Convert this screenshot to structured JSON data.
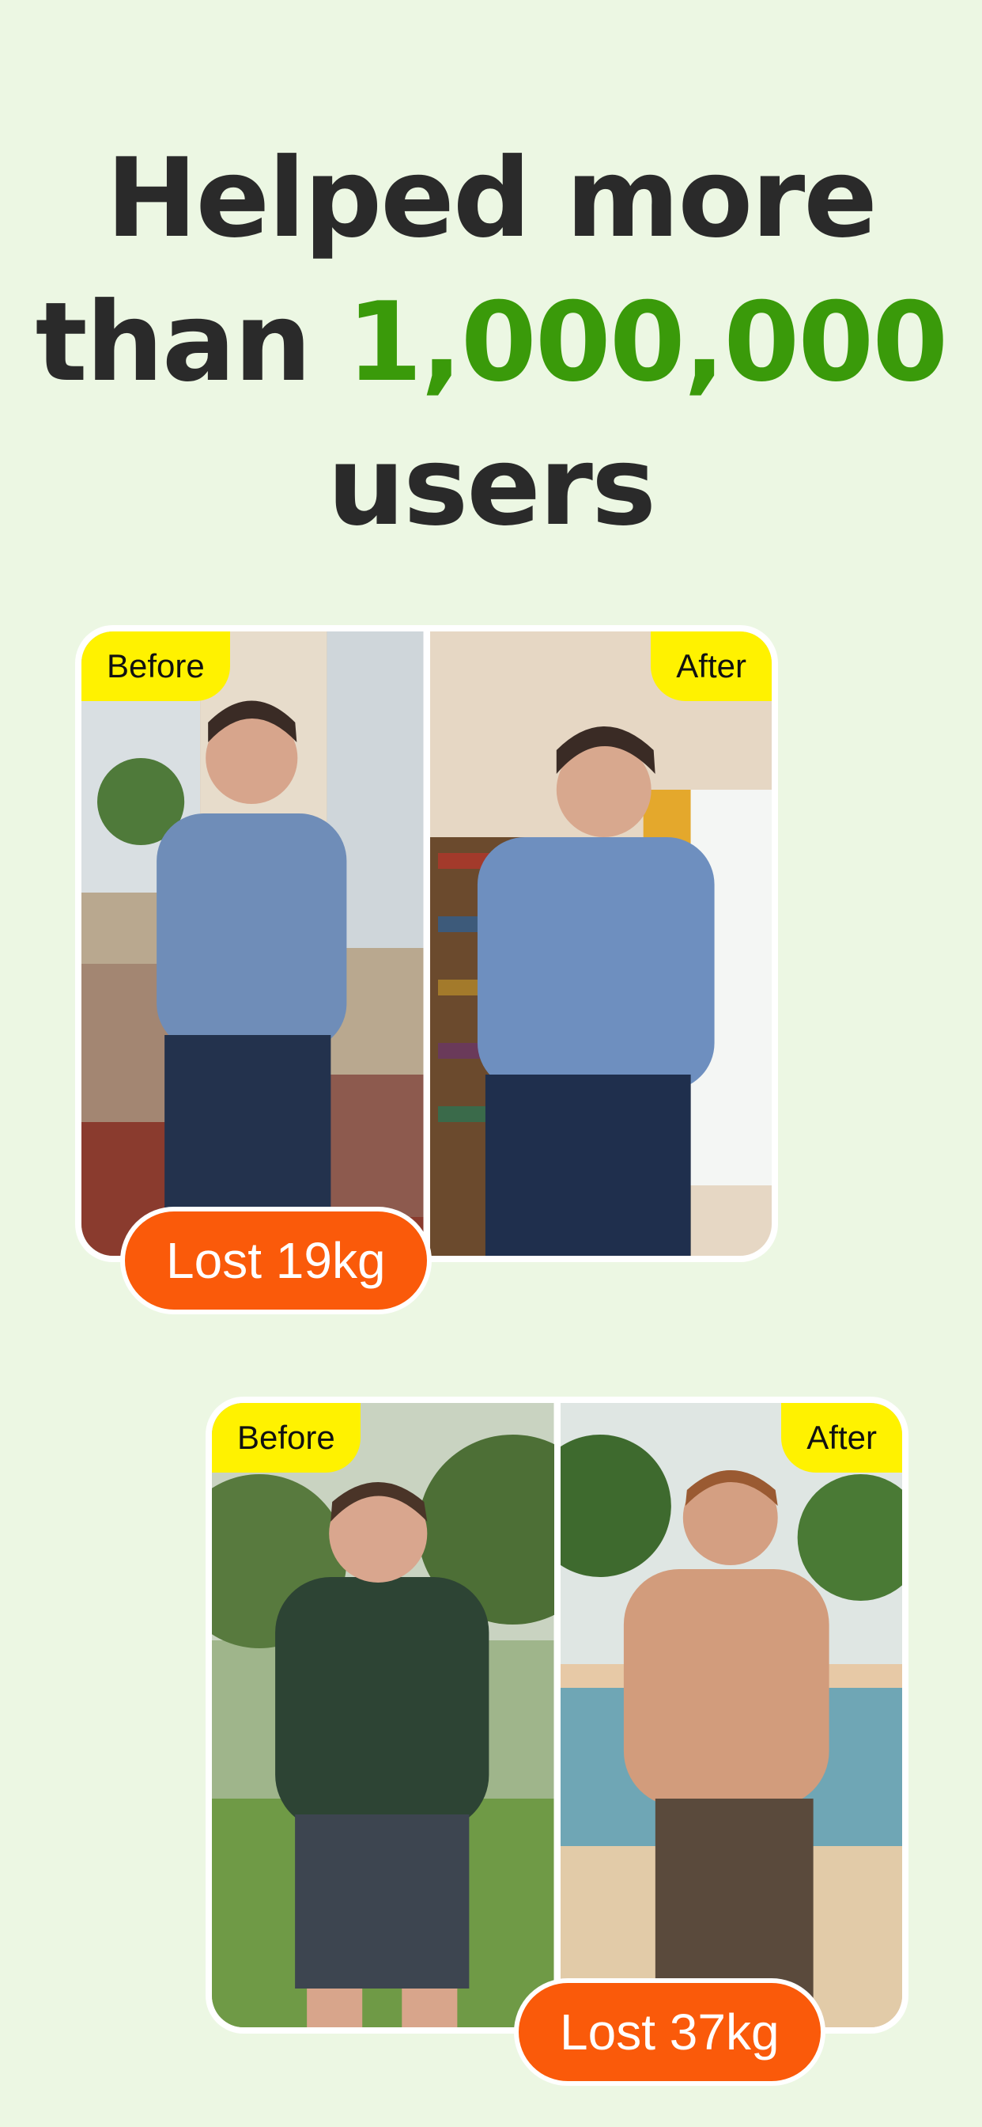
{
  "headline": {
    "line1": "Helped more",
    "line2_prefix": "than ",
    "highlight": "1,000,000",
    "line3": "users"
  },
  "testimonials": [
    {
      "before_label": "Before",
      "after_label": "After",
      "result": "Lost 19kg"
    },
    {
      "before_label": "Before",
      "after_label": "After",
      "result": "Lost 37kg"
    }
  ],
  "colors": {
    "background": "#ecf7e3",
    "highlight_green": "#3a9a0a",
    "tag_yellow": "#fff200",
    "badge_orange": "#fa5a0a"
  }
}
